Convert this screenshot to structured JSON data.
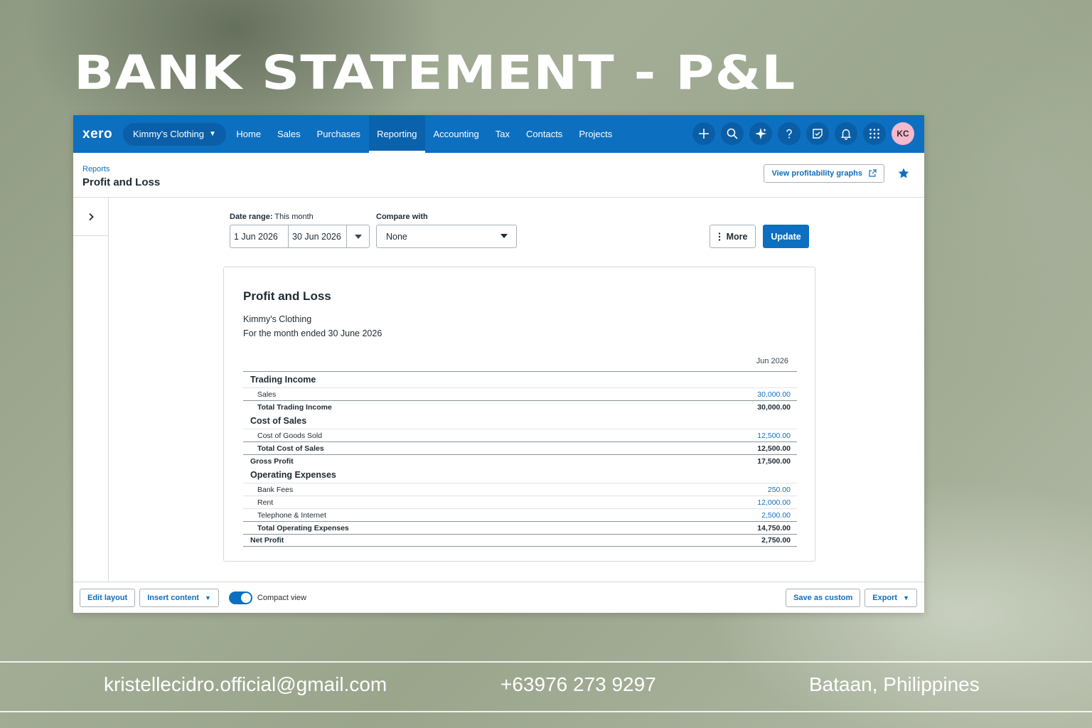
{
  "hero": {
    "title": "BANK STATEMENT - P&L"
  },
  "topbar": {
    "logo": "xero",
    "org": "Kimmy's Clothing",
    "nav": [
      "Home",
      "Sales",
      "Purchases",
      "Reporting",
      "Accounting",
      "Tax",
      "Contacts",
      "Projects"
    ],
    "active_nav": "Reporting",
    "avatar": "KC"
  },
  "pagehead": {
    "breadcrumb": "Reports",
    "title": "Profit and Loss",
    "graphs_button": "View profitability graphs"
  },
  "filters": {
    "date_range_label": "Date range:",
    "date_range_value": "This month",
    "from": "1 Jun 2026",
    "to": "30 Jun 2026",
    "compare_label": "Compare with",
    "compare_value": "None",
    "more_button": "More",
    "update_button": "Update"
  },
  "report": {
    "title": "Profit and Loss",
    "org": "Kimmy's Clothing",
    "period": "For the month ended 30 June 2026",
    "column": "Jun 2026",
    "sections": {
      "trading_income": {
        "title": "Trading Income",
        "lines": [
          {
            "label": "Sales",
            "value": "30,000.00"
          }
        ],
        "total_label": "Total Trading Income",
        "total_value": "30,000.00"
      },
      "cost_of_sales": {
        "title": "Cost of Sales",
        "lines": [
          {
            "label": "Cost of Goods Sold",
            "value": "12,500.00"
          }
        ],
        "total_label": "Total Cost of Sales",
        "total_value": "12,500.00"
      },
      "gross_profit": {
        "label": "Gross Profit",
        "value": "17,500.00"
      },
      "operating_expenses": {
        "title": "Operating Expenses",
        "lines": [
          {
            "label": "Bank Fees",
            "value": "250.00"
          },
          {
            "label": "Rent",
            "value": "12,000.00"
          },
          {
            "label": "Telephone & Internet",
            "value": "2,500.00"
          }
        ],
        "total_label": "Total Operating Expenses",
        "total_value": "14,750.00"
      },
      "net_profit": {
        "label": "Net Profit",
        "value": "2,750.00"
      }
    }
  },
  "footer": {
    "edit_layout": "Edit layout",
    "insert_content": "Insert content",
    "compact_view": "Compact view",
    "compact_on": true,
    "save_custom": "Save as custom",
    "export": "Export"
  },
  "contact": {
    "email": "kristellecidro.official@gmail.com",
    "phone": "+63976 273 9297",
    "location": "Bataan, Philippines"
  },
  "colors": {
    "brand": "#0d6fc0",
    "avatar": "#f5b8cc"
  },
  "icons": [
    "plus-icon",
    "search-icon",
    "sparkle-icon",
    "help-icon",
    "notes-icon",
    "bell-icon",
    "apps-grid-icon",
    "external-link-icon",
    "star-icon",
    "chevron-right-icon",
    "caret-down-icon",
    "kebab-icon"
  ]
}
